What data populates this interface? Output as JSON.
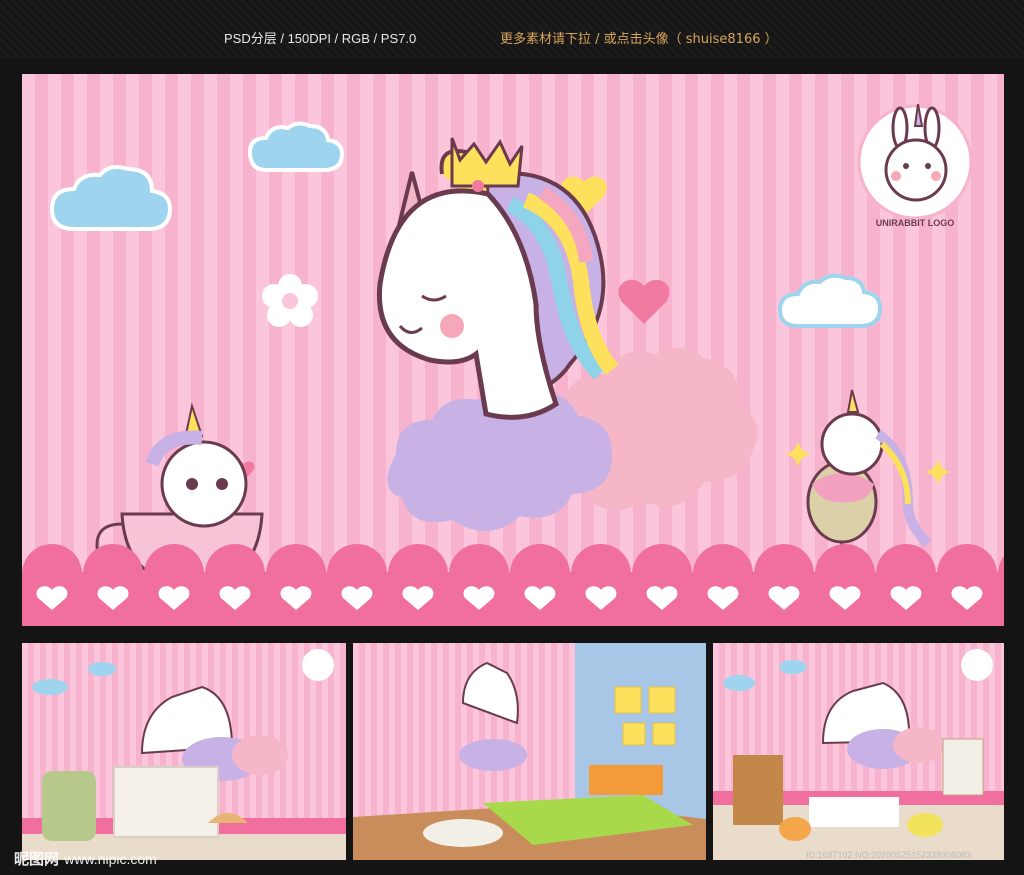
{
  "header": {
    "spec": "PSD分层 / 150DPI / RGB / PS7.0",
    "more": "更多素材请下拉 / 或点击头像（ shuise8166 ）"
  },
  "logo": {
    "text": "UNIRABBIT LOGO"
  },
  "watermark": {
    "site": "昵图网",
    "url": "www.nipic.com",
    "id": "ID:1687102 NO:20200525152339306083"
  },
  "colors": {
    "stripe_light": "#fbc6dc",
    "stripe_dark": "#f7b3cd",
    "heart_band": "#f06f9e",
    "cloud_blue": "#9fd4ef",
    "moon": "#fce14a",
    "cloud_purple": "#c7b1e5",
    "cloud_pink": "#f5b6c8"
  },
  "icons": [
    "moon-icon",
    "cloud-icon",
    "flower-icon",
    "heart-icon",
    "star-icon",
    "unicorn-illustration",
    "rabbit-logo-icon",
    "balloon-icon",
    "teacup-icon"
  ]
}
